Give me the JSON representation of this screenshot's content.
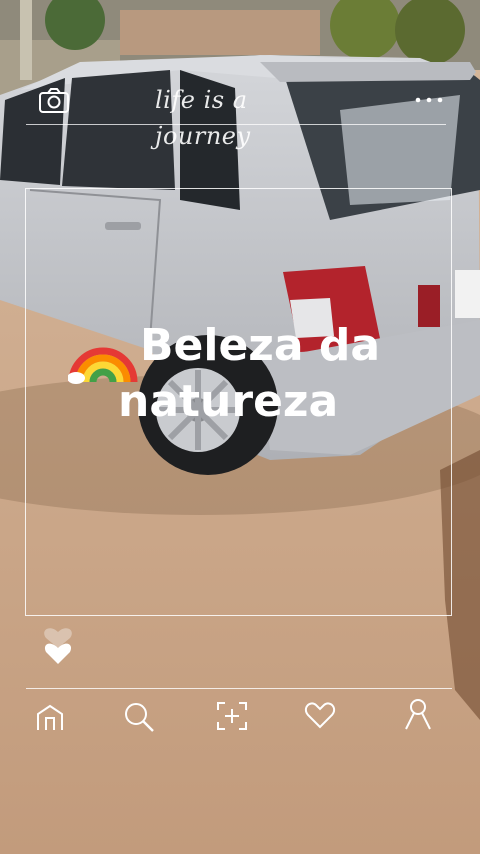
{
  "overlay": {
    "top_script_text": "life is a journey",
    "title_line1": "Beleza da",
    "title_line2": "natureza",
    "title_emoji": "rainbow"
  },
  "icons": {
    "top_left": "camera-icon",
    "top_right": "more-dots-icon",
    "floating": "heart-icon",
    "bottom_bar": [
      "home-icon",
      "search-icon",
      "add-post-icon",
      "heart-icon",
      "profile-icon"
    ]
  },
  "colors": {
    "overlay_white": "#ffffff",
    "car_silver": "#c9cbcf",
    "tail_light_red": "#b3232c",
    "ground_dirt": "#c7a486"
  }
}
